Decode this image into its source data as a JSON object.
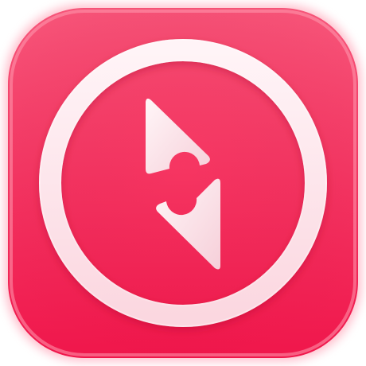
{
  "icon": {
    "name": "compass-app-icon",
    "glyph": "compass-needle-icon",
    "colors": {
      "background_top": "#f7567a",
      "background_bottom": "#f0164b",
      "ring": "#fde6ec",
      "needle": "#fbe7ec",
      "outer_glow": "#ff8aa3"
    }
  }
}
